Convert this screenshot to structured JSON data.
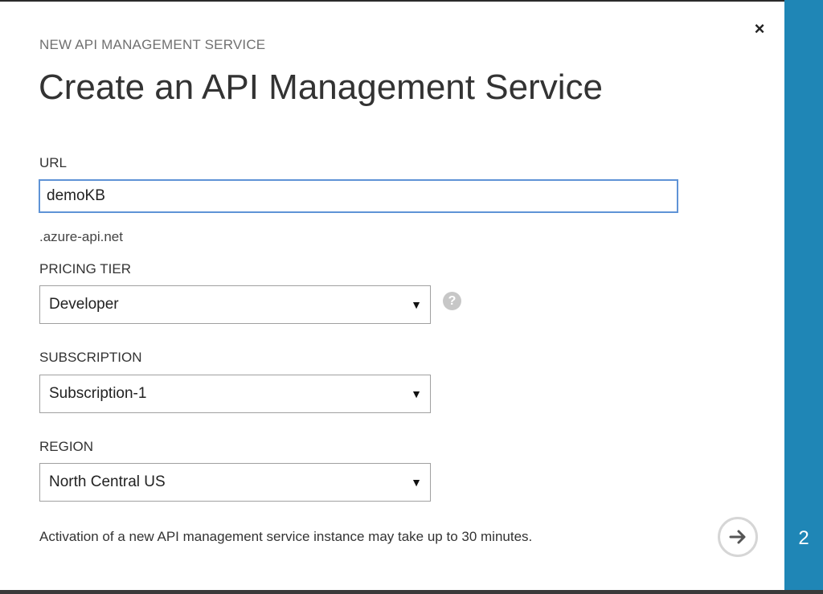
{
  "dialog": {
    "subtitle": "NEW API MANAGEMENT SERVICE",
    "title": "Create an API Management Service",
    "close_glyph": "×",
    "step_number": "2",
    "colors": {
      "side_strip": "#1f86b6",
      "input_focus_border": "#5f93d6"
    }
  },
  "form": {
    "url": {
      "label": "URL",
      "value": "demoKB",
      "suffix": ".azure-api.net"
    },
    "pricing_tier": {
      "label": "PRICING TIER",
      "selected": "Developer",
      "help_glyph": "?"
    },
    "subscription": {
      "label": "SUBSCRIPTION",
      "selected": "Subscription-1"
    },
    "region": {
      "label": "REGION",
      "selected": "North Central US"
    },
    "dropdown_arrow": "▼"
  },
  "footer": {
    "note": "Activation of a new API management service instance may take up to 30 minutes."
  },
  "icons": {
    "close": "close-icon",
    "help": "help-icon",
    "next": "arrow-right-icon"
  }
}
